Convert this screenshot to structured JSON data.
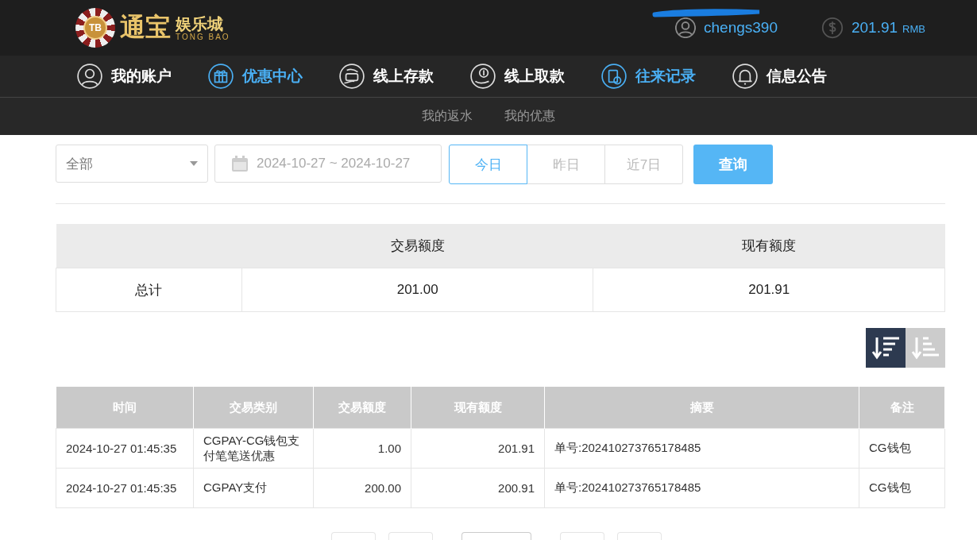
{
  "header": {
    "logo": {
      "badge": "TB",
      "title": "通宝",
      "subtitle": "娱乐城",
      "latin": "TONG BAO"
    },
    "user": {
      "name": "chengs390",
      "redacted": true
    },
    "balance": {
      "amount": "201.91",
      "currency": "RMB"
    }
  },
  "nav": [
    {
      "label": "我的账户",
      "kind": "user",
      "highlighted": false
    },
    {
      "label": "优惠中心",
      "kind": "gift",
      "highlighted": true
    },
    {
      "label": "线上存款",
      "kind": "deposit",
      "highlighted": false
    },
    {
      "label": "线上取款",
      "kind": "withdraw",
      "highlighted": false
    },
    {
      "label": "往来记录",
      "kind": "record",
      "highlighted": true
    },
    {
      "label": "信息公告",
      "kind": "bell",
      "highlighted": false
    }
  ],
  "subnav": [
    "我的返水",
    "我的优惠"
  ],
  "filters": {
    "type_select": "全部",
    "date_range": "2024-10-27 ~ 2024-10-27",
    "quick_ranges": [
      {
        "label": "今日",
        "selected": true
      },
      {
        "label": "昨日",
        "selected": false
      },
      {
        "label": "近7日",
        "selected": false
      }
    ],
    "query_button": "查询"
  },
  "summary": {
    "columns": [
      "交易额度",
      "现有额度"
    ],
    "rows": [
      {
        "label": "总计",
        "cells": [
          "201.00",
          "201.91"
        ]
      }
    ]
  },
  "sort_buttons": [
    {
      "kind": "desc",
      "selected": true
    },
    {
      "kind": "asc",
      "selected": false
    }
  ],
  "table": {
    "columns": [
      "时间",
      "交易类别",
      "交易额度",
      "现有额度",
      "摘要",
      "备注"
    ],
    "rows": [
      [
        "2024-10-27 01:45:35",
        "CGPAY-CG钱包支付笔笔送优惠",
        "1.00",
        "201.91",
        "单号:202410273765178485",
        "CG钱包"
      ],
      [
        "2024-10-27 01:45:35",
        "CGPAY支付",
        "200.00",
        "200.91",
        "单号:202410273765178485",
        "CG钱包"
      ]
    ]
  },
  "pagination": [
    {
      "kind": "page"
    },
    {
      "kind": "page"
    },
    {
      "kind": "input"
    },
    {
      "kind": "page"
    },
    {
      "kind": "page"
    }
  ]
}
